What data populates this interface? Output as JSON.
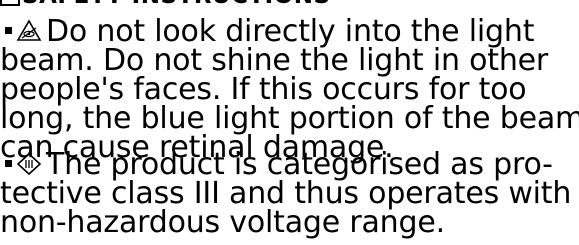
{
  "heading": {
    "text": "SAFETY INSTRUCTIONS",
    "icon": "safety-heading-icon"
  },
  "items": [
    {
      "icon": "no-eye-contact-warning-icon",
      "lines": [
        "Do not look directly into the light",
        "beam. Do not shine the light in other",
        "people's faces. If this occurs for too",
        "long, the blue light portion of the beam",
        "can cause retinal damage."
      ]
    },
    {
      "icon": "protection-class-iii-icon",
      "lines": [
        "The product is categorised as pro-",
        "tective class III and thus operates with a",
        "non-hazardous voltage range."
      ]
    }
  ]
}
